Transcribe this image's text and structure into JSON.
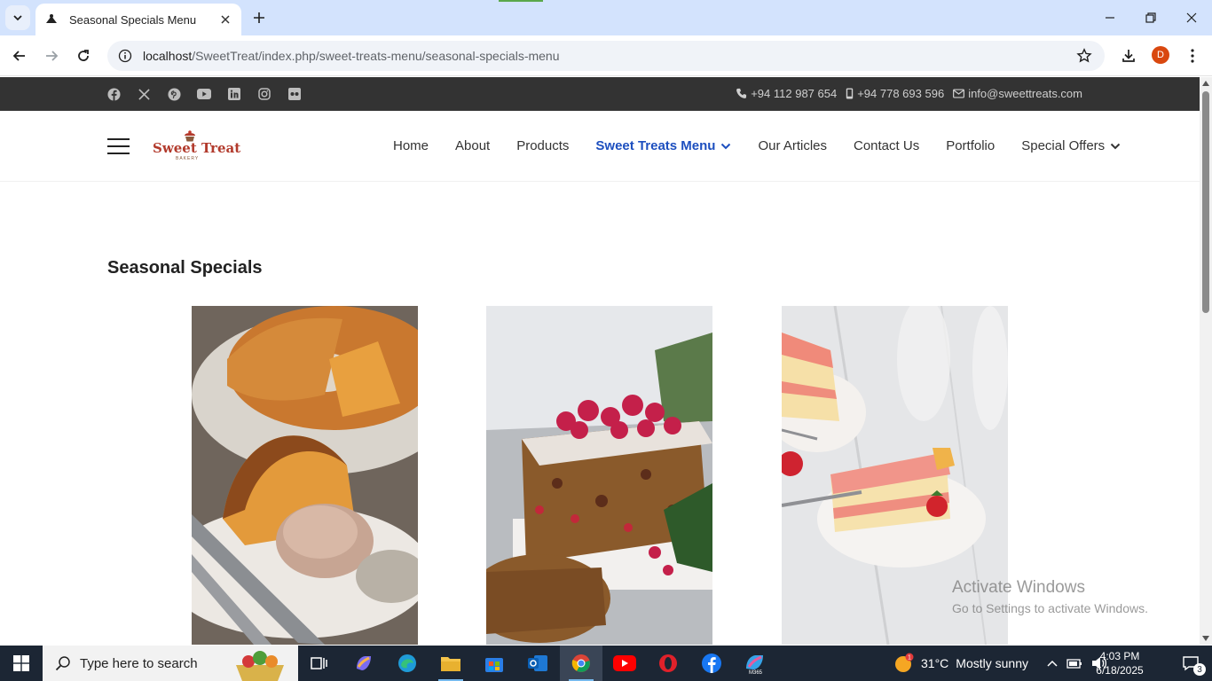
{
  "browser": {
    "tab_title": "Seasonal Specials Menu",
    "url_host": "localhost",
    "url_path": "/SweetTreat/index.php/sweet-treats-menu/seasonal-specials-menu",
    "profile_initial": "D"
  },
  "topbar": {
    "social_icons": [
      "facebook-icon",
      "x-icon",
      "pinterest-icon",
      "youtube-icon",
      "linkedin-icon",
      "instagram-icon",
      "flickr-icon"
    ],
    "phone": "+94 112 987 654",
    "mobile": "+94 778 693 596",
    "email": "info@sweettreats.com"
  },
  "logo": {
    "name": "Sweet Treat",
    "sub": "BAKERY"
  },
  "nav": {
    "home": "Home",
    "about": "About",
    "products": "Products",
    "menu": "Sweet Treats Menu",
    "articles": "Our Articles",
    "contact": "Contact Us",
    "portfolio": "Portfolio",
    "offers": "Special Offers"
  },
  "main": {
    "section_title": "Seasonal Specials",
    "cards": [
      {
        "image": "pumpkin bundt cake with whipped cream"
      },
      {
        "image": "fruit cake with sugared cranberries"
      },
      {
        "image": "strawberry layer cake slices"
      }
    ]
  },
  "watermark": {
    "line1": "Activate Windows",
    "line2": "Go to Settings to activate Windows."
  },
  "taskbar": {
    "search_placeholder": "Type here to search",
    "weather_temp": "31°C",
    "weather_text": "Mostly sunny",
    "time": "4:03 PM",
    "date": "6/18/2025",
    "notifications": "3"
  },
  "colors": {
    "accent": "#1d4fbf",
    "topbar": "#333333",
    "taskbar": "#1c2634"
  }
}
